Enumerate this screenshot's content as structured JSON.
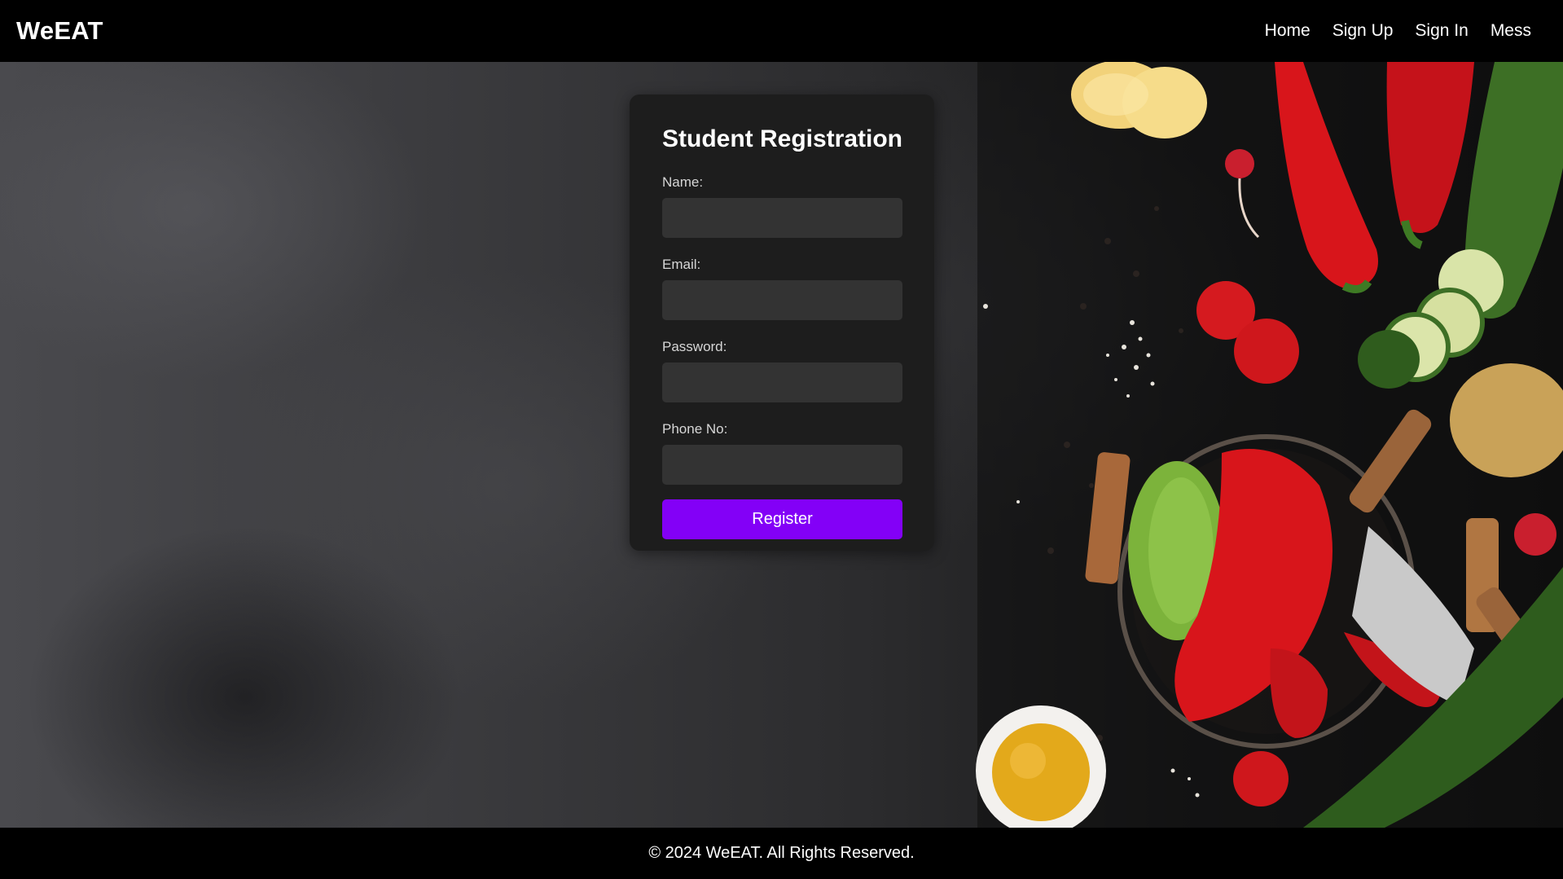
{
  "header": {
    "brand": "WeEAT",
    "nav": [
      {
        "label": "Home"
      },
      {
        "label": "Sign Up"
      },
      {
        "label": "Sign In"
      },
      {
        "label": "Mess"
      }
    ]
  },
  "form": {
    "title": "Student Registration",
    "fields": [
      {
        "label": "Name:",
        "value": ""
      },
      {
        "label": "Email:",
        "value": ""
      },
      {
        "label": "Password:",
        "value": ""
      },
      {
        "label": "Phone No:",
        "value": ""
      }
    ],
    "submit_label": "Register"
  },
  "footer": {
    "text": "© 2024 WeEAT. All Rights Reserved."
  },
  "colors": {
    "header_bg": "#000000",
    "card_bg": "#1d1d1d",
    "input_bg": "#333333",
    "accent": "#8300f7"
  },
  "background": {
    "image": "dark slate surface with vegetables (corn, red chili peppers, zucchini, tomatoes, radishes, bell peppers, lettuce, potato, mezzaluna knife in wire basket, bowl of oil, salt and peppercorns)"
  }
}
